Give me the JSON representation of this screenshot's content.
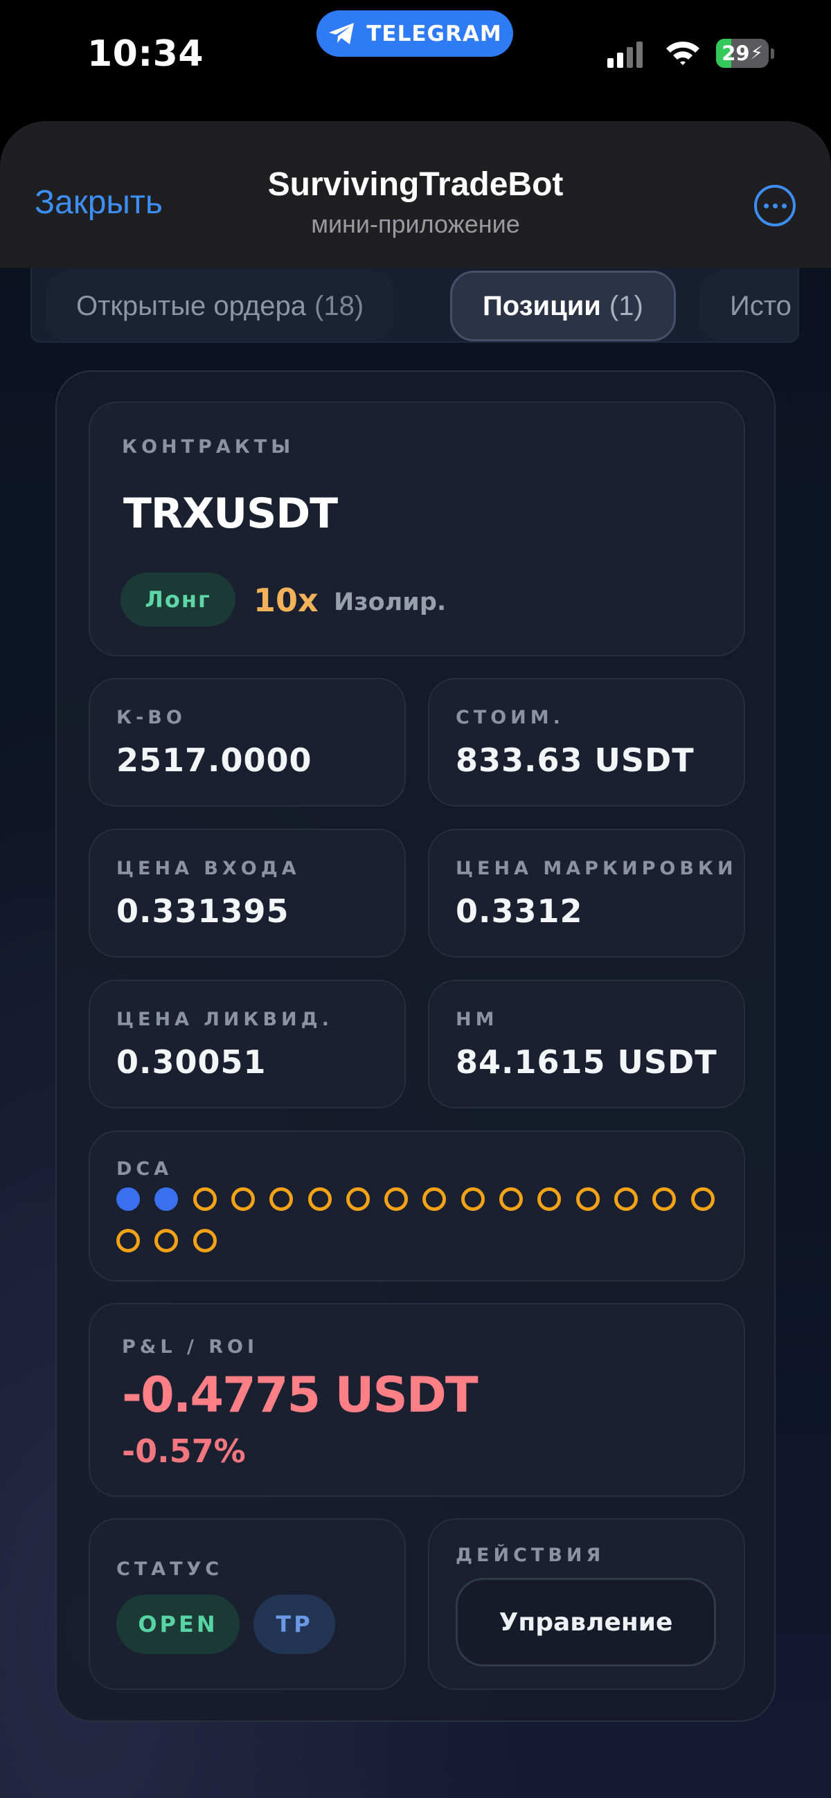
{
  "status_bar": {
    "time": "10:34",
    "telegram_label": "TELEGRAM",
    "battery": "29",
    "battery_level": 0.29
  },
  "header": {
    "close_label": "Закрыть",
    "title": "SurvivingTradeBot",
    "subtitle": "мини-приложение"
  },
  "tabs": [
    {
      "label": "Открытые ордера",
      "count": "(18)",
      "active": false
    },
    {
      "label": "Позиции",
      "count": "(1)",
      "active": true
    },
    {
      "label": "Исто",
      "count": "",
      "active": false
    }
  ],
  "position": {
    "contracts_caption": "КОНТРАКТЫ",
    "symbol": "TRXUSDT",
    "side": "Лонг",
    "leverage": "10x",
    "margin_mode": "Изолир.",
    "qty_caption": "К-ВО",
    "qty": "2517.0000",
    "value_caption": "СТОИМ.",
    "value": "833.63 USDT",
    "entry_caption": "ЦЕНА ВХОДА",
    "entry": "0.331395",
    "mark_caption": "ЦЕНА МАРКИРОВКИ",
    "mark": "0.3312",
    "liq_caption": "ЦЕНА ЛИКВИД.",
    "liq": "0.30051",
    "nm_caption": "НМ",
    "nm": "84.1615 USDT",
    "dca_caption": "DCA",
    "dca_filled": 2,
    "dca_total": 19,
    "pnl_caption": "P&L / ROI",
    "pnl": "-0.4775 USDT",
    "roi": "-0.57%",
    "status_caption": "СТАТУС",
    "status_open": "OPEN",
    "status_tp": "TP",
    "actions_caption": "ДЕЙСТВИЯ",
    "manage_label": "Управление"
  },
  "colors": {
    "accent": "#3d8ef5",
    "telegram": "#2f7bf5",
    "long": "#5fd6a8",
    "leverage": "#f2b25a",
    "negative": "#ff7f86",
    "dca_filled": "#3a6ff0",
    "dca_empty": "#f5a316"
  }
}
